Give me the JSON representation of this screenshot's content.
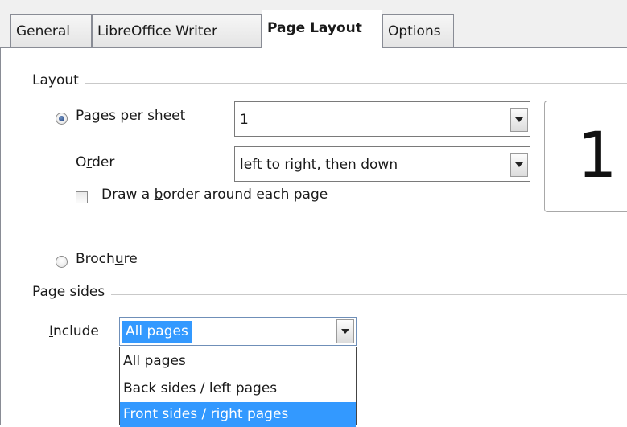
{
  "tabs": [
    {
      "label": "General"
    },
    {
      "label": "LibreOffice Writer"
    },
    {
      "label": "Page Layout"
    },
    {
      "label": "Options"
    }
  ],
  "layout": {
    "title": "Layout",
    "pages_per_sheet": {
      "label": "Pages per sheet",
      "selected": true,
      "value": "1"
    },
    "order": {
      "label": "Order",
      "value": "left to right, then down"
    },
    "draw_border": {
      "label": "Draw a border around each page",
      "checked": false
    },
    "brochure": {
      "label": "Brochure",
      "selected": false
    },
    "preview_number": "1"
  },
  "page_sides": {
    "title": "Page sides",
    "include_label": "Include",
    "include_value": "All pages",
    "options": [
      "All pages",
      "Back sides / left pages",
      "Front sides / right pages"
    ],
    "highlighted_option": "Front sides / right pages"
  }
}
